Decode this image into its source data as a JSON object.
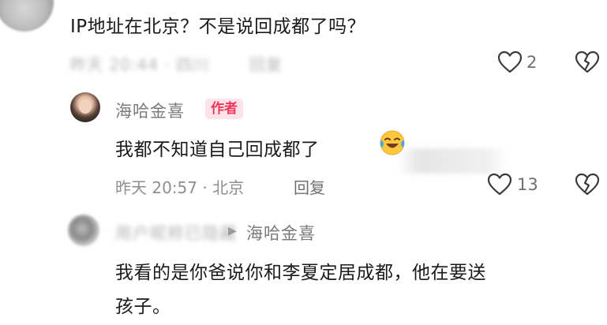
{
  "comments": [
    {
      "text": "IP地址在北京？不是说回成都了吗？",
      "meta_blurred": "昨天 20:44 · 四川",
      "reply_blurred": "回复",
      "like_count": "2"
    },
    {
      "username": "海哈金喜",
      "badge": "作者",
      "text": "我都不知道自己回成都了",
      "time": "昨天 20:57 · 北京",
      "reply_label": "回复",
      "like_count": "13"
    },
    {
      "username_blurred": "用户昵称已隐藏",
      "reply_arrow": "▶",
      "reply_to": "海哈金喜",
      "text_line1": "我看的是你爸说你和李夏定居成都，他在要送",
      "text_line2": "孩子。"
    }
  ],
  "icons": {
    "like": "heart-outline-icon",
    "dislike": "broken-heart-icon",
    "emoji": "crying-laughing-emoji-icon"
  }
}
